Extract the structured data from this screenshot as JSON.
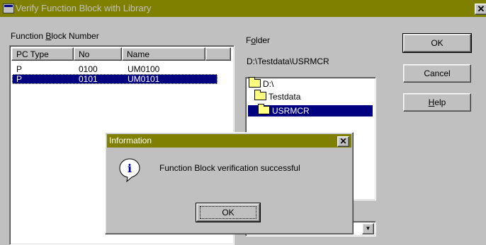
{
  "main_window": {
    "title": "Verify Function Block with Library",
    "close_glyph": "✕"
  },
  "function_block": {
    "label_pre": "Function ",
    "label_accel": "B",
    "label_post": "lock Number",
    "columns": [
      "PC Type",
      "No",
      "Name"
    ],
    "rows": [
      {
        "pc_type": "P",
        "no": "0100",
        "name": "UM0100"
      },
      {
        "pc_type": "P",
        "no": "0101",
        "name": "UM0101"
      }
    ]
  },
  "folder": {
    "label_pre": "F",
    "label_accel": "o",
    "label_post": "lder",
    "path": "D:\\Testdata\\USRMCR",
    "tree": [
      "D:\\",
      "Testdata",
      "USRMCR"
    ]
  },
  "buttons": {
    "ok": "OK",
    "cancel": "Cancel",
    "help_accel": "H",
    "help_rest": "elp"
  },
  "info_dialog": {
    "title": "Information",
    "close_glyph": "✕",
    "message": "Function Block verification successful",
    "ok": "OK",
    "icon_glyph": "i"
  },
  "colors": {
    "titlebar": "#808000",
    "selection": "#000080",
    "face": "#c0c0c0"
  }
}
